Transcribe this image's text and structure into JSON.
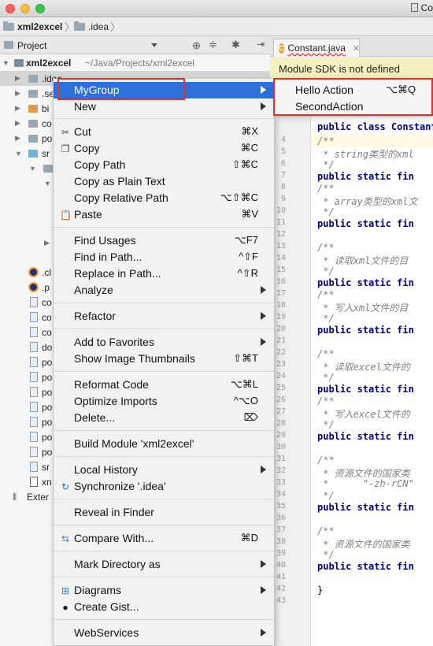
{
  "window": {
    "title_partial": "Co"
  },
  "breadcrumb": {
    "project": "xml2excel",
    "folder": ".idea"
  },
  "project_panel": {
    "header_label": "Project"
  },
  "tree": {
    "root_name": "xml2excel",
    "root_path": "~/Java/Projects/xml2excel",
    "idea_label": ".idea",
    "items": [
      ".se",
      "bi",
      "co",
      "po",
      "sr",
      ".cl",
      ".p",
      "co",
      "co",
      "co",
      "do",
      "po",
      "po",
      "po",
      "po",
      "po",
      "po",
      "po",
      "sr",
      "xn"
    ],
    "external_label": "Exter"
  },
  "editor": {
    "tab_label": "Constant.java",
    "sdk_banner": "Module SDK is not defined",
    "line_numbers": [
      "4",
      "5",
      "6",
      "7",
      "8",
      "9",
      "10",
      "11",
      "12",
      "13",
      "14",
      "15",
      "16",
      "17",
      "18",
      "19",
      "20",
      "21",
      "22",
      "23",
      "24",
      "25",
      "26",
      "27",
      "28",
      "29",
      "30",
      "31",
      "32",
      "33",
      "34",
      "35",
      "36",
      "37",
      "38",
      "39",
      "40",
      "41",
      "42",
      "43"
    ],
    "class_line": "public class Constant",
    "lines": [
      "/**",
      " * string类型的xml",
      " */",
      "public static fin",
      "/**",
      " * array类型的xml文",
      " */",
      "public static fin",
      "",
      "/**",
      " * 读取xml文件的目",
      " */",
      "public static fin",
      "/**",
      " * 写入xml文件的目",
      " */",
      "public static fin",
      "",
      "/**",
      " * 读取excel文件的",
      " */",
      "public static fin",
      "/**",
      " * 写入excel文件的",
      " */",
      "public static fin",
      "",
      "/**",
      " * 资源文件的国家类",
      " *      \"-zh-rCN\"",
      " */",
      "public static fin",
      "",
      "/**",
      " * 资源文件的国家类",
      " */",
      "public static fin",
      "",
      "}",
      ""
    ]
  },
  "context_menu": {
    "items": [
      {
        "label": "MyGroup",
        "shortcut": "",
        "submenu": true,
        "highlighted": true,
        "icon": ""
      },
      {
        "label": "New",
        "shortcut": "",
        "submenu": true,
        "icon": ""
      },
      {
        "label": "Cut",
        "shortcut": "⌘X",
        "icon": "scissors-icon"
      },
      {
        "label": "Copy",
        "shortcut": "⌘C",
        "icon": "copy-icon"
      },
      {
        "label": "Copy Path",
        "shortcut": "⇧⌘C",
        "icon": ""
      },
      {
        "label": "Copy as Plain Text",
        "shortcut": "",
        "icon": ""
      },
      {
        "label": "Copy Relative Path",
        "shortcut": "⌥⇧⌘C",
        "icon": ""
      },
      {
        "label": "Paste",
        "shortcut": "⌘V",
        "icon": "paste-icon"
      },
      {
        "label": "Find Usages",
        "shortcut": "⌥F7",
        "icon": ""
      },
      {
        "label": "Find in Path...",
        "shortcut": "^⇧F",
        "icon": ""
      },
      {
        "label": "Replace in Path...",
        "shortcut": "^⇧R",
        "icon": ""
      },
      {
        "label": "Analyze",
        "shortcut": "",
        "submenu": true,
        "icon": ""
      },
      {
        "label": "Refactor",
        "shortcut": "",
        "submenu": true,
        "icon": ""
      },
      {
        "label": "Add to Favorites",
        "shortcut": "",
        "submenu": true,
        "icon": ""
      },
      {
        "label": "Show Image Thumbnails",
        "shortcut": "⇧⌘T",
        "icon": ""
      },
      {
        "label": "Reformat Code",
        "shortcut": "⌥⌘L",
        "icon": ""
      },
      {
        "label": "Optimize Imports",
        "shortcut": "^⌥O",
        "icon": ""
      },
      {
        "label": "Delete...",
        "shortcut": "⌦",
        "icon": ""
      },
      {
        "label": "Build Module 'xml2excel'",
        "shortcut": "",
        "icon": ""
      },
      {
        "label": "Local History",
        "shortcut": "",
        "submenu": true,
        "icon": ""
      },
      {
        "label": "Synchronize '.idea'",
        "shortcut": "",
        "icon": "sync-icon"
      },
      {
        "label": "Reveal in Finder",
        "shortcut": "",
        "icon": ""
      },
      {
        "label": "Compare With...",
        "shortcut": "⌘D",
        "icon": "compare-icon"
      },
      {
        "label": "Mark Directory as",
        "shortcut": "",
        "submenu": true,
        "icon": ""
      },
      {
        "label": "Diagrams",
        "shortcut": "",
        "submenu": true,
        "icon": "diagram-icon"
      },
      {
        "label": "Create Gist...",
        "shortcut": "",
        "icon": "github-icon"
      },
      {
        "label": "WebServices",
        "shortcut": "",
        "submenu": true,
        "icon": ""
      }
    ]
  },
  "submenu": {
    "items": [
      {
        "label": "Hello Action",
        "shortcut": "⌥⌘Q"
      },
      {
        "label": "SecondAction",
        "shortcut": ""
      }
    ]
  },
  "colors": {
    "highlight": "#2f6fd9",
    "annotation_red": "#e0322b",
    "sdk_banner_bg": "#f5f0c0"
  }
}
